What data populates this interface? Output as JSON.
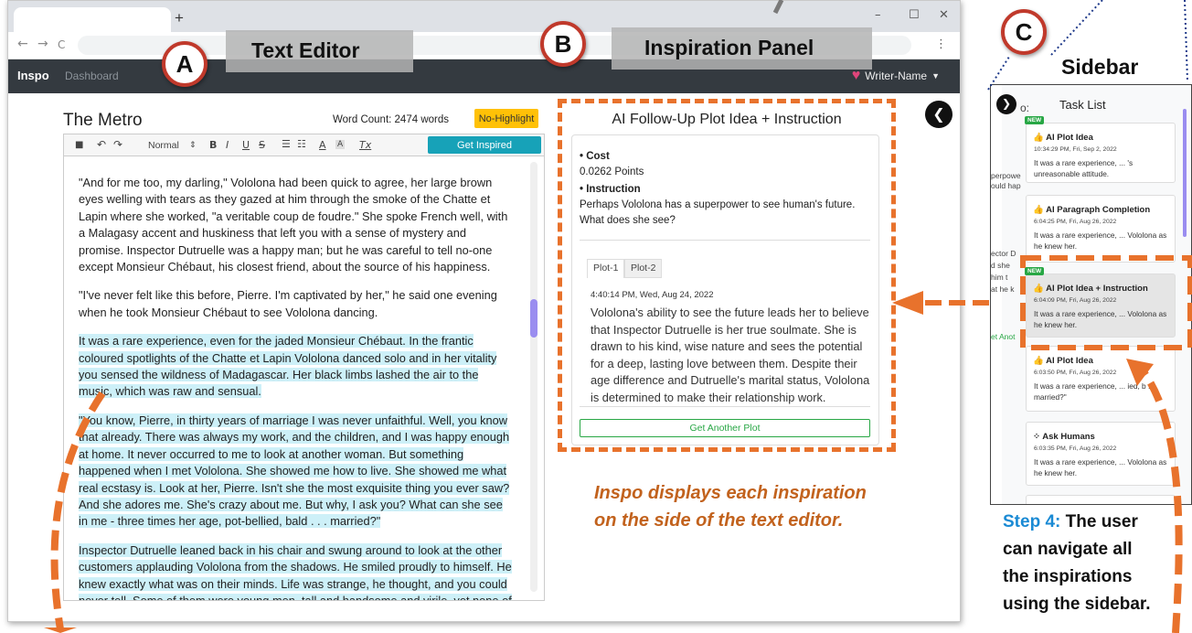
{
  "browser": {
    "new_tab": "+",
    "back": "←",
    "forward": "→",
    "reload": "C",
    "minimize": "–",
    "maximize": "☐",
    "close": "✕",
    "menu": "⋮"
  },
  "app": {
    "brand": "Inspo",
    "nav_dashboard": "Dashboard",
    "user_name": "Writer-Name",
    "user_caret": "▼"
  },
  "editor": {
    "title": "The Metro",
    "word_count": "Word Count: 2474 words",
    "no_highlight": "No-Highlight",
    "toolbar": {
      "save": "■",
      "undo": "↶",
      "redo": "↷",
      "style": "Normal",
      "style_arrow": "⇕",
      "bold": "B",
      "italic": "I",
      "underline": "U",
      "strike": "S",
      "ordered_list": "☰",
      "bullet_list": "☷",
      "color": "A",
      "highlight": "A",
      "clear": "Tx",
      "get_inspired": "Get Inspired"
    },
    "paragraphs": [
      "\"And for me too, my darling,\" Vololona had been quick to agree, her large brown eyes welling with tears as they gazed at him through the smoke of the Chatte et Lapin where she worked, \"a veritable coup de foudre.\" She spoke French well, with a Malagasy accent and huskiness that left you with a sense of mystery and promise. Inspector Dutruelle was a happy man; but he was careful to tell no-one except Monsieur Chébaut, his closest friend, about the source of his happiness.",
      "\"I've never felt like this before, Pierre. I'm captivated by her,\" he said one evening when he took Monsieur Chébaut to see Vololona dancing.",
      "It was a rare experience, even for the jaded Monsieur Chébaut. In the frantic coloured spotlights of the Chatte et Lapin Vololona danced solo and in her vitality you sensed the wildness of Madagascar. Her black limbs lashed the air to the music, which was raw and sensual.",
      "\"You know, Pierre, in thirty years of marriage I was never unfaithful. Well, you know that already. There was always my work, and the children, and I was happy enough at home. It never occurred to me to look at another woman. But something happened when I met Vololona. She showed me how to live. She showed me what real ecstasy is. Look at her, Pierre. Isn't she the most exquisite thing you ever saw? And she adores me. She's crazy about me. But why, I ask you? What can she see in me - three times her age, pot-bellied, bald . . . married?\"",
      "Inspector Dutruelle leaned back in his chair and swung around to look at the other customers applauding Vololona from the shadows. He smiled proudly to himself. He knew exactly what was on their minds. Life was strange, he thought, and you could never tell. Some of them were young men, tall and handsome and virile, yet none of them knew"
    ]
  },
  "panel": {
    "title": "AI Follow-Up Plot Idea + Instruction",
    "cost_label": "• Cost",
    "cost_value": "0.0262 Points",
    "instruction_label": "• Instruction",
    "instruction_text": "Perhaps Vololona has a superpower to see human's future. What does she see?",
    "tabs": [
      "Plot-1",
      "Plot-2"
    ],
    "timestamp": "4:40:14 PM, Wed, Aug 24, 2022",
    "plot_text": "Vololona's ability to see the future leads her to believe that Inspector Dutruelle is her true soulmate. She is drawn to his kind, wise nature and sees the potential for a deep, lasting love between them. Despite their age difference and Dutruelle's marital status, Vololona is determined to make their relationship work.",
    "another_button": "Get Another Plot",
    "toggle_icon": "❮"
  },
  "annotations": {
    "label_a": "A",
    "label_b": "B",
    "label_c": "C",
    "text_editor": "Text Editor",
    "inspiration_panel": "Inspiration Panel",
    "sidebar": "Sidebar",
    "caption_line1": "Inspo displays each inspiration",
    "caption_line2": "on the side of the text editor.",
    "step_label": "Step 4:",
    "step_text": "The user can navigate all the inspirations using the sidebar.",
    "accent_color": "#e8722c"
  },
  "sidebar": {
    "title": "Task List",
    "toggle_icon": "❯",
    "peek": [
      "o:",
      "perpowe",
      "ould hap",
      "ector D",
      "d she",
      "him t",
      "at he k",
      "et Anot"
    ],
    "tasks": [
      {
        "badge": "NEW",
        "icon": "👍",
        "title": "AI Plot Idea",
        "time": "10:34:29 PM, Fri, Sep 2, 2022",
        "text": "It was a rare experience, ... 's unreasonable attitude."
      },
      {
        "badge": "",
        "icon": "👍",
        "title": "AI Paragraph Completion",
        "time": "6:04:25 PM, Fri, Aug 26, 2022",
        "text": "It was a rare experience, ... Vololona as he knew her."
      },
      {
        "badge": "NEW",
        "icon": "👍",
        "title": "AI Plot Idea + Instruction",
        "time": "6:04:09 PM, Fri, Aug 26, 2022",
        "text": "It was a rare experience, ... Vololona as he knew her."
      },
      {
        "badge": "",
        "icon": "👍",
        "title": "AI Plot Idea",
        "time": "6:03:50 PM, Fri, Aug 26, 2022",
        "text": "It was a rare experience, ... ied, b . . married?\""
      },
      {
        "badge": "",
        "icon": "⁘",
        "title": "Ask Humans",
        "time": "6:03:35 PM, Fri, Aug 26, 2022",
        "text": "It was a rare experience, ... Vololona as he knew her."
      }
    ]
  }
}
